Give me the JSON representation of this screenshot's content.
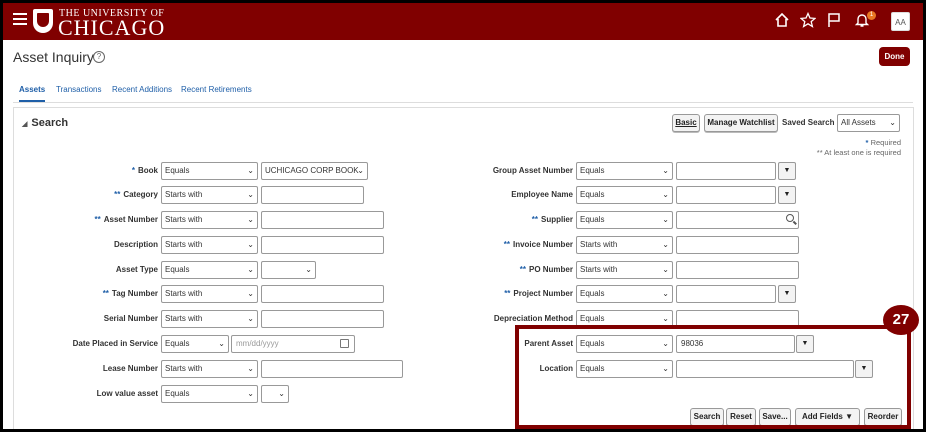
{
  "header": {
    "brand_top": "THE UNIVERSITY OF",
    "brand_main": "CHICAGO",
    "bell_count": "1",
    "avatar_initials": "AA",
    "icons": [
      "menu-icon",
      "home-icon",
      "star-icon",
      "flag-icon",
      "bell-icon"
    ],
    "brand_color": "#800000"
  },
  "page": {
    "title": "Asset Inquiry",
    "help_glyph": "?",
    "done_label": "Done"
  },
  "tabs": [
    {
      "label": "Assets"
    },
    {
      "label": "Transactions"
    },
    {
      "label": "Recent Additions"
    },
    {
      "label": "Recent Retirements"
    }
  ],
  "search": {
    "title": "Search",
    "basic_label": "Basic",
    "watchlist_label": "Manage Watchlist",
    "saved_search_label": "Saved Search",
    "saved_search_value": "All Assets",
    "required_note": "Required",
    "atleast_note": "** At least one is required",
    "left_fields": [
      {
        "label": "Book",
        "mark": "*",
        "op": "Equals",
        "value": "UCHICAGO CORP BOOK"
      },
      {
        "label": "Category",
        "mark": "**",
        "op": "Starts with",
        "value": ""
      },
      {
        "label": "Asset Number",
        "mark": "**",
        "op": "Starts with",
        "value": ""
      },
      {
        "label": "Description",
        "mark": "",
        "op": "Starts with",
        "value": ""
      },
      {
        "label": "Asset Type",
        "mark": "",
        "op": "Equals",
        "value": ""
      },
      {
        "label": "Tag Number",
        "mark": "**",
        "op": "Starts with",
        "value": ""
      },
      {
        "label": "Serial Number",
        "mark": "",
        "op": "Starts with",
        "value": ""
      },
      {
        "label": "Date Placed in Service",
        "mark": "",
        "op": "Equals",
        "value": "",
        "placeholder": "mm/dd/yyyy"
      },
      {
        "label": "Lease Number",
        "mark": "",
        "op": "Starts with",
        "value": ""
      },
      {
        "label": "Low value asset",
        "mark": "",
        "op": "Equals",
        "value": ""
      }
    ],
    "right_fields": [
      {
        "label": "Group Asset Number",
        "mark": "",
        "op": "Equals",
        "value": ""
      },
      {
        "label": "Employee Name",
        "mark": "",
        "op": "Equals",
        "value": ""
      },
      {
        "label": "Supplier",
        "mark": "**",
        "op": "Equals",
        "value": ""
      },
      {
        "label": "Invoice Number",
        "mark": "**",
        "op": "Starts with",
        "value": ""
      },
      {
        "label": "PO Number",
        "mark": "**",
        "op": "Starts with",
        "value": ""
      },
      {
        "label": "Project Number",
        "mark": "**",
        "op": "Equals",
        "value": ""
      },
      {
        "label": "Depreciation Method",
        "mark": "",
        "op": "Equals",
        "value": ""
      },
      {
        "label": "Parent Asset",
        "mark": "",
        "op": "Equals",
        "value": "98036"
      },
      {
        "label": "Location",
        "mark": "",
        "op": "Equals",
        "value": ""
      }
    ],
    "buttons": {
      "search": "Search",
      "reset": "Reset",
      "save": "Save...",
      "add_fields": "Add Fields",
      "reorder": "Reorder"
    }
  },
  "callout": "27"
}
